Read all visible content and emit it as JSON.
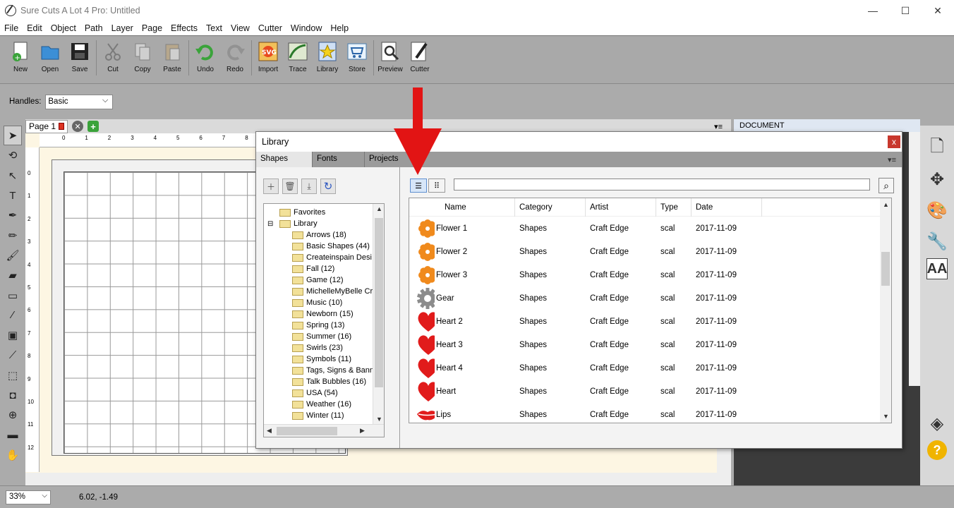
{
  "window": {
    "title": "Sure Cuts A Lot 4 Pro: Untitled"
  },
  "menu": [
    "File",
    "Edit",
    "Object",
    "Path",
    "Layer",
    "Page",
    "Effects",
    "Text",
    "View",
    "Cutter",
    "Window",
    "Help"
  ],
  "toolbar": [
    {
      "label": "New",
      "icon": "new-icon",
      "enabled": true
    },
    {
      "label": "Open",
      "icon": "open-icon",
      "enabled": true
    },
    {
      "label": "Save",
      "icon": "save-icon",
      "enabled": true
    },
    {
      "sep": true
    },
    {
      "label": "Cut",
      "icon": "cut-icon",
      "enabled": false
    },
    {
      "label": "Copy",
      "icon": "copy-icon",
      "enabled": false
    },
    {
      "label": "Paste",
      "icon": "paste-icon",
      "enabled": false
    },
    {
      "sep": true
    },
    {
      "label": "Undo",
      "icon": "undo-icon",
      "enabled": true
    },
    {
      "label": "Redo",
      "icon": "redo-icon",
      "enabled": false
    },
    {
      "sep": true
    },
    {
      "label": "Import",
      "icon": "import-icon",
      "enabled": true
    },
    {
      "label": "Trace",
      "icon": "trace-icon",
      "enabled": true
    },
    {
      "label": "Library",
      "icon": "library-icon",
      "enabled": true
    },
    {
      "label": "Store",
      "icon": "store-icon",
      "enabled": true
    },
    {
      "sep": true
    },
    {
      "label": "Preview",
      "icon": "preview-icon",
      "enabled": true
    },
    {
      "label": "Cutter",
      "icon": "cutter-icon",
      "enabled": true
    }
  ],
  "handles": {
    "label": "Handles:",
    "value": "Basic"
  },
  "page_tab": {
    "label": "Page 1"
  },
  "doc_panel": {
    "title": "DOCUMENT"
  },
  "status": {
    "zoom": "33%",
    "coords": "6.02, -1.49"
  },
  "library": {
    "title": "Library",
    "close": "x",
    "tabs": [
      "Shapes",
      "Fonts",
      "Projects"
    ],
    "tree": [
      {
        "label": "Favorites",
        "level": 1
      },
      {
        "label": "Library",
        "level": 1,
        "expander": "⊟"
      },
      {
        "label": "Arrows (18)",
        "level": 2
      },
      {
        "label": "Basic Shapes (44)",
        "level": 2
      },
      {
        "label": "Createinspain Desi",
        "level": 2
      },
      {
        "label": "Fall (12)",
        "level": 2
      },
      {
        "label": "Game (12)",
        "level": 2
      },
      {
        "label": "MichelleMyBelle Cre",
        "level": 2
      },
      {
        "label": "Music (10)",
        "level": 2
      },
      {
        "label": "Newborn (15)",
        "level": 2
      },
      {
        "label": "Spring (13)",
        "level": 2
      },
      {
        "label": "Summer (16)",
        "level": 2
      },
      {
        "label": "Swirls (23)",
        "level": 2
      },
      {
        "label": "Symbols (11)",
        "level": 2
      },
      {
        "label": "Tags, Signs & Bann",
        "level": 2
      },
      {
        "label": "Talk Bubbles (16)",
        "level": 2
      },
      {
        "label": "USA (54)",
        "level": 2
      },
      {
        "label": "Weather (16)",
        "level": 2
      },
      {
        "label": "Winter (11)",
        "level": 2
      }
    ],
    "columns": [
      "Name",
      "Category",
      "Artist",
      "Type",
      "Date"
    ],
    "rows": [
      {
        "icon": "flower-icon",
        "color": "#f08a1c",
        "name": "Flower 1",
        "category": "Shapes",
        "artist": "Craft Edge",
        "type": "scal",
        "date": "2017-11-09"
      },
      {
        "icon": "flower-icon",
        "color": "#f08a1c",
        "name": "Flower 2",
        "category": "Shapes",
        "artist": "Craft Edge",
        "type": "scal",
        "date": "2017-11-09"
      },
      {
        "icon": "flower-icon",
        "color": "#f08a1c",
        "name": "Flower 3",
        "category": "Shapes",
        "artist": "Craft Edge",
        "type": "scal",
        "date": "2017-11-09"
      },
      {
        "icon": "gear-icon",
        "color": "#8c8c8c",
        "name": "Gear",
        "category": "Shapes",
        "artist": "Craft Edge",
        "type": "scal",
        "date": "2017-11-09"
      },
      {
        "icon": "heart-icon",
        "color": "#e11b1b",
        "name": "Heart 2",
        "category": "Shapes",
        "artist": "Craft Edge",
        "type": "scal",
        "date": "2017-11-09"
      },
      {
        "icon": "heart-icon",
        "color": "#e11b1b",
        "name": "Heart 3",
        "category": "Shapes",
        "artist": "Craft Edge",
        "type": "scal",
        "date": "2017-11-09"
      },
      {
        "icon": "heart-icon",
        "color": "#e11b1b",
        "name": "Heart 4",
        "category": "Shapes",
        "artist": "Craft Edge",
        "type": "scal",
        "date": "2017-11-09"
      },
      {
        "icon": "heart-icon",
        "color": "#e11b1b",
        "name": "Heart",
        "category": "Shapes",
        "artist": "Craft Edge",
        "type": "scal",
        "date": "2017-11-09"
      },
      {
        "icon": "lips-icon",
        "color": "#e11b1b",
        "name": "Lips",
        "category": "Shapes",
        "artist": "Craft Edge",
        "type": "scal",
        "date": "2017-11-09"
      }
    ]
  },
  "ruler_top": [
    "0",
    "1",
    "2",
    "3",
    "4",
    "5",
    "6",
    "7",
    "8"
  ],
  "ruler_left": [
    "0",
    "1",
    "2",
    "3",
    "4",
    "5",
    "6",
    "7",
    "8",
    "9",
    "10",
    "11",
    "12"
  ]
}
